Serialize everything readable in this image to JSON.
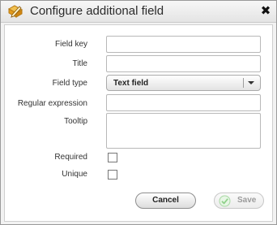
{
  "dialog": {
    "title": "Configure additional field",
    "title_icon": "edit-form-icon",
    "close_glyph": "✖",
    "close_icon": "close-icon"
  },
  "form": {
    "field_key": {
      "label": "Field key",
      "value": ""
    },
    "title": {
      "label": "Title",
      "value": ""
    },
    "field_type": {
      "label": "Field type",
      "selected": "Text field",
      "arrow_icon": "chevron-down-icon"
    },
    "regular_expression": {
      "label": "Regular expression",
      "value": ""
    },
    "tooltip": {
      "label": "Tooltip",
      "value": ""
    },
    "required": {
      "label": "Required",
      "checked": false
    },
    "unique": {
      "label": "Unique",
      "checked": false
    }
  },
  "buttons": {
    "cancel_label": "Cancel",
    "save_label": "Save",
    "save_icon": "check-icon",
    "save_disabled": true
  },
  "colors": {
    "accent_icon": "#e7a520",
    "save_check": "#8fd18a"
  }
}
